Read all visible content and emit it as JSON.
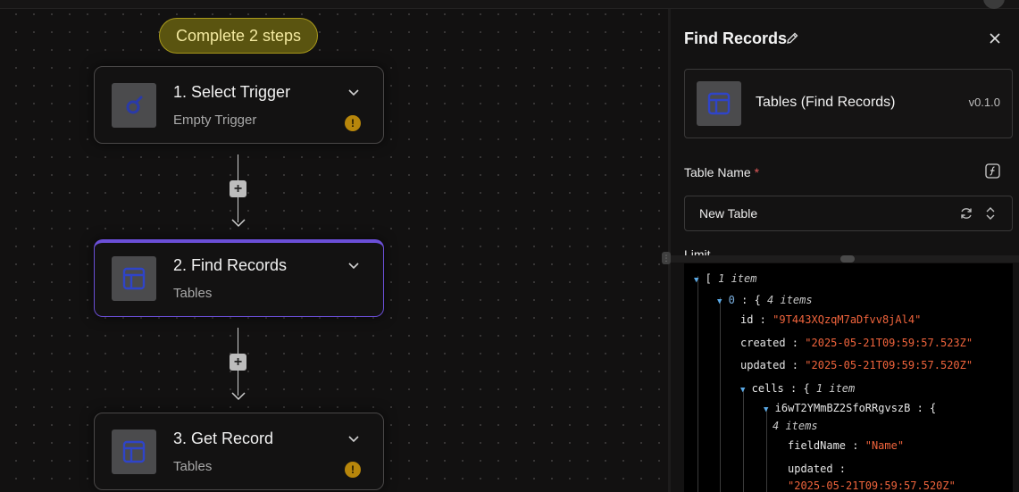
{
  "canvas": {
    "steps_pill": "Complete 2 steps",
    "nodes": [
      {
        "title": "1. Select Trigger",
        "subtitle": "Empty Trigger",
        "icon": "trigger-icon",
        "warning": "!"
      },
      {
        "title": "2. Find Records",
        "subtitle": "Tables",
        "icon": "table-icon"
      },
      {
        "title": "3. Get Record",
        "subtitle": "Tables",
        "icon": "table-icon",
        "warning": "!"
      }
    ],
    "add_symbol": "+"
  },
  "panel": {
    "title": "Find Records",
    "piece": {
      "name": "Tables (Find Records)",
      "version": "v0.1.0"
    },
    "table_name": {
      "label": "Table Name",
      "required_mark": "*",
      "value": "New Table"
    },
    "limit_label": "Limit",
    "json": {
      "root_bracket": "[",
      "root_meta": "1 item",
      "item0_key": "0",
      "item0_meta": "4 items",
      "id_key": "id",
      "id_value": "\"9T443XQzqM7aDfvv8jAl4\"",
      "created_key": "created",
      "created_value": "\"2025-05-21T09:59:57.523Z\"",
      "updated_key": "updated",
      "updated_value": "\"2025-05-21T09:59:57.520Z\"",
      "cells_key": "cells",
      "cells_meta": "1 item",
      "cell_key": "i6wT2YMmBZ2SfoRRgvszB",
      "cell_meta": "4 items",
      "fieldname_key": "fieldName",
      "fieldname_value": "\"Name\"",
      "cell_updated_key": "updated",
      "cell_updated_value": "\"2025-05-21T09:59:57.520Z\""
    }
  },
  "colors": {
    "accent": "#6b4fd8",
    "warning": "#b7860b",
    "pill": "#5a5410",
    "json_string": "#f0643c"
  }
}
